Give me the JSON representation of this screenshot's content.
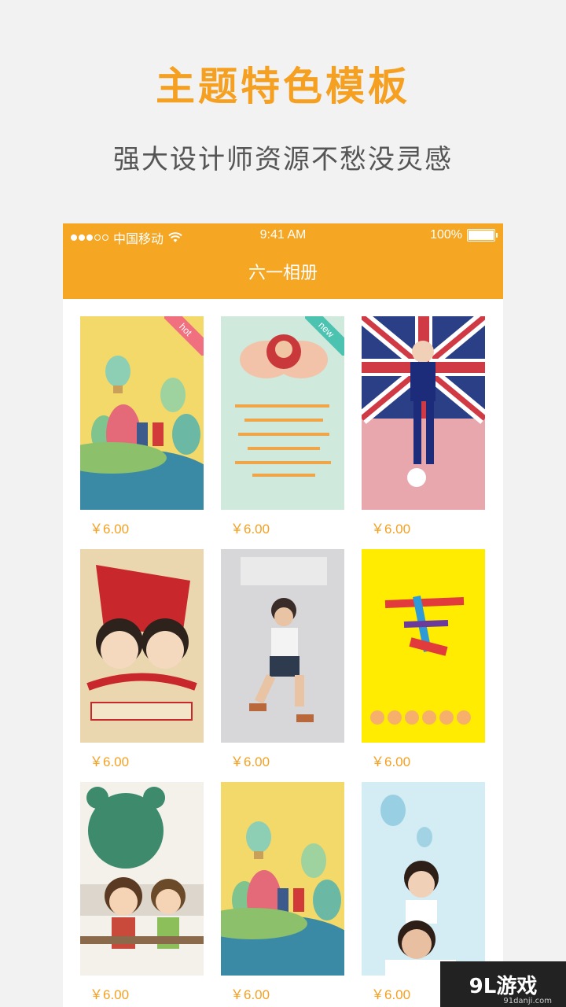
{
  "headline": "主题特色模板",
  "subline": "强大设计师资源不愁没灵感",
  "status_bar": {
    "carrier": "中国移动",
    "time": "9:41 AM",
    "battery": "100%"
  },
  "nav_title": "六一相册",
  "templates": [
    {
      "price": "￥6.00",
      "tag": "hot"
    },
    {
      "price": "￥6.00",
      "tag": "new"
    },
    {
      "price": "￥6.00"
    },
    {
      "price": "￥6.00"
    },
    {
      "price": "￥6.00"
    },
    {
      "price": "￥6.00"
    },
    {
      "price": "￥6.00"
    },
    {
      "price": "￥6.00"
    },
    {
      "price": "￥6.00"
    }
  ],
  "watermark": {
    "logo": "9L游戏",
    "site": "91danji.com"
  },
  "colors": {
    "accent": "#f5a623",
    "headline": "#f5a020",
    "hot": "#f07080",
    "new": "#4cc3b0"
  }
}
